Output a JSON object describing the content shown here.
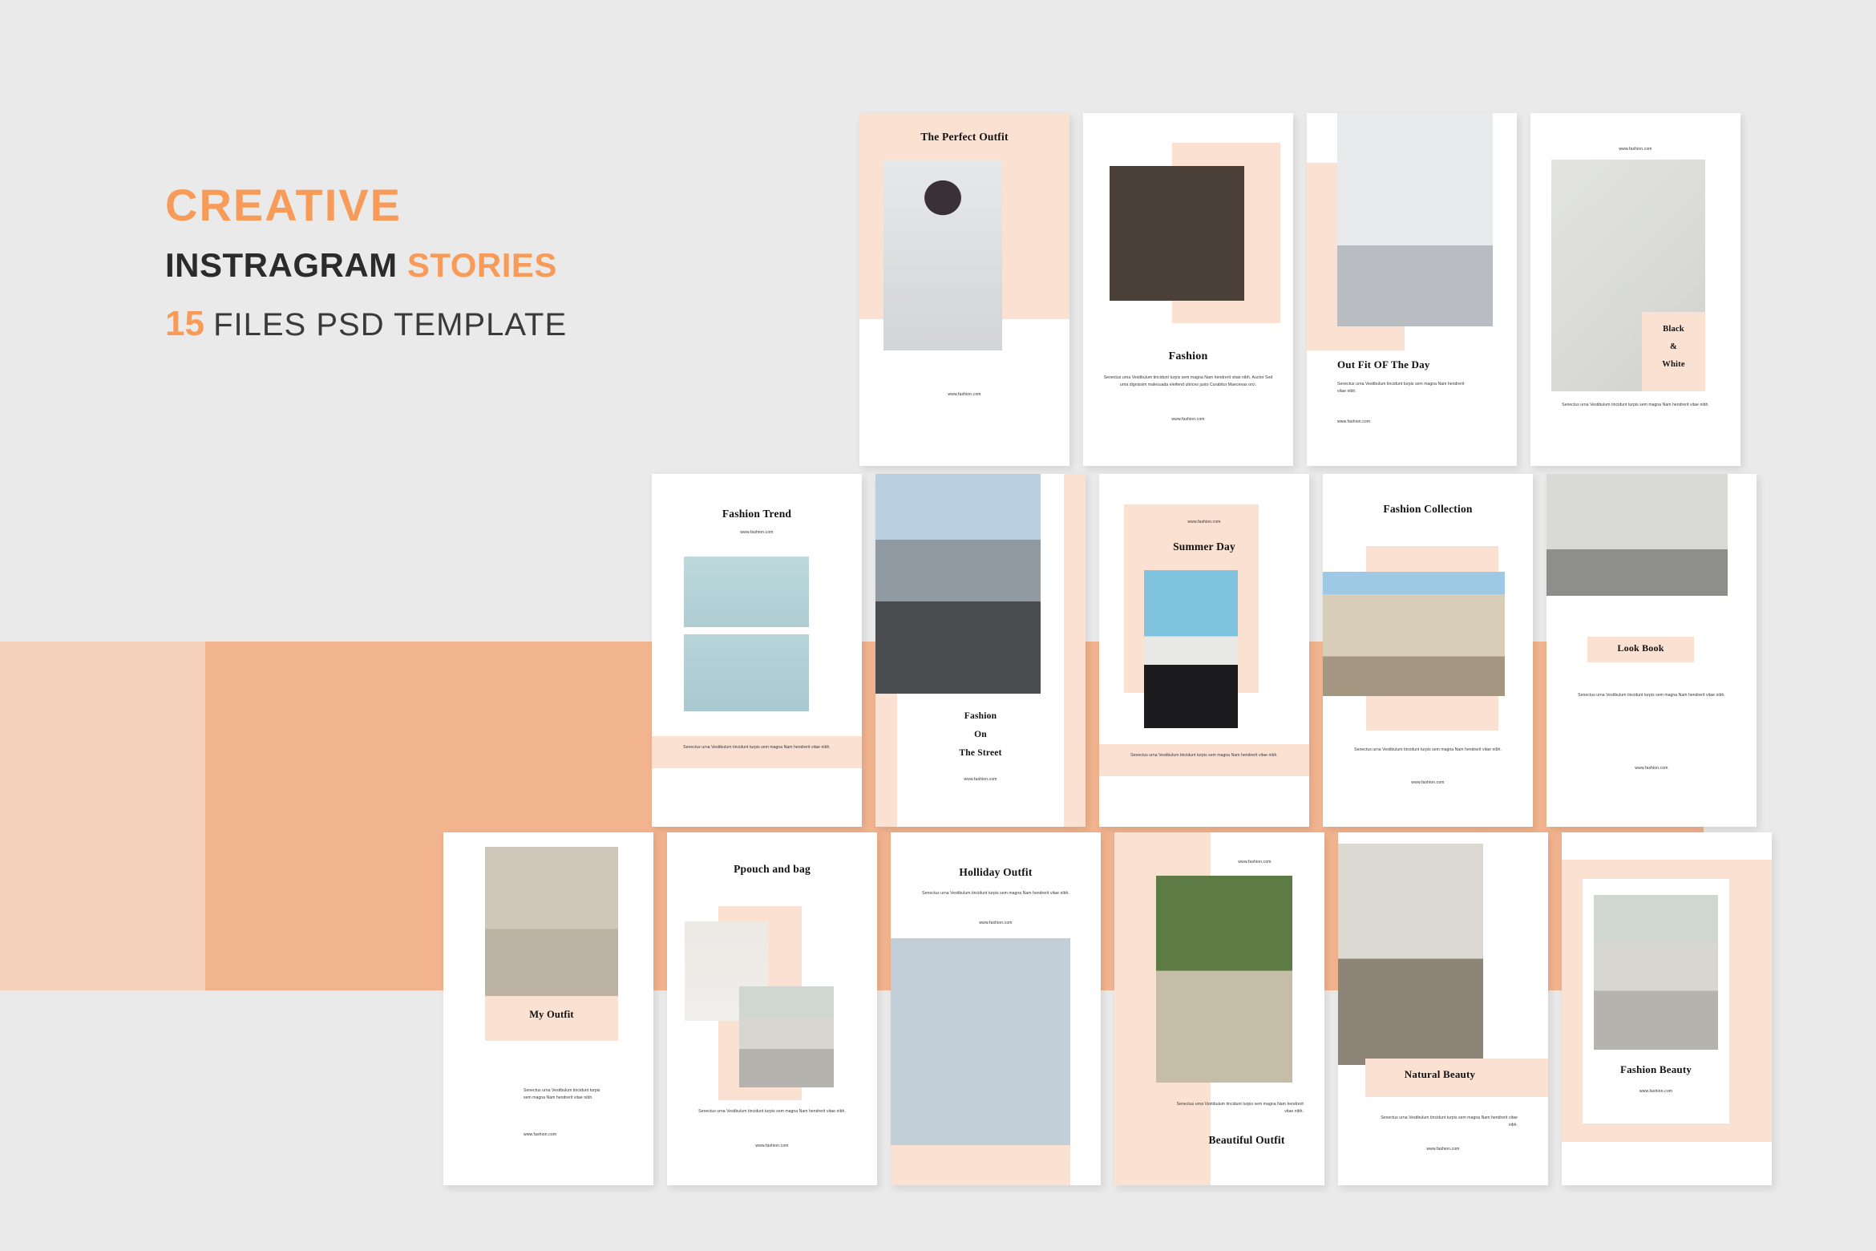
{
  "colors": {
    "page_bg": "#eaeaea",
    "band_light": "#f7d2ba",
    "band_dark": "#f2b48e",
    "accent_orange": "#f89b58",
    "card_peach": "#fbe1d2",
    "heading_dark": "#2b2b2b"
  },
  "headline": {
    "line1": "CREATIVE",
    "line2_dark": "INSTRAGRAM",
    "line2_accent": "STORIES",
    "line3_number": "15",
    "line3_rest": "FILES PSD TEMPLATE"
  },
  "common": {
    "url": "www.fashion.com",
    "body_short": "Senectus urna Vestibulum tincidunt turpis sem magna Nam hendrerit vitae nibh.",
    "body_long": "Senectus urna Vestibulum tincidunt turpis sem magna Nam hendrerit vitae nibh. Auctor Sed urna dignissim malesuada eleifend ultrices justo Curabitur Maecenas orci."
  },
  "cards": [
    {
      "id": "the-perfect-outfit",
      "title": "The Perfect Outfit",
      "url": "www.fashion.com"
    },
    {
      "id": "fashion",
      "title": "Fashion",
      "body": "Senectus urna Vestibulum tincidunt turpis sem magna Nam hendrerit vitae nibh. Auctor Sed urna dignissim malesuada eleifend ultrices justo Curabitur Maecenas orci.",
      "url": "www.fashion.com"
    },
    {
      "id": "out-fit-of-the-day",
      "title": "Out Fit OF The Day",
      "body": "Senectus urna Vestibulum tincidunt turpis sem magna Nam hendrerit vitae nibh.",
      "url": "www.fashion.com"
    },
    {
      "id": "black-and-white",
      "title_line1": "Black",
      "title_line2": "&",
      "title_line3": "White",
      "body": "Senectus urna Vestibulum tincidunt turpis sem magna Nam hendrerit vitae nibh.",
      "url": "www.fashion.com"
    },
    {
      "id": "fashion-trend",
      "title": "Fashion Trend",
      "body": "Senectus urna Vestibulum tincidunt turpis sem magna Nam hendrerit vitae nibh.",
      "url": "www.fashion.com"
    },
    {
      "id": "fashion-on-the-street",
      "title_line1": "Fashion",
      "title_line2": "On",
      "title_line3": "The Street",
      "url": "www.fashion.com"
    },
    {
      "id": "summer-day",
      "title": "Summer Day",
      "body": "Senectus urna Vestibulum tincidunt turpis sem magna Nam hendrerit vitae nibh.",
      "url": "www.fashion.com"
    },
    {
      "id": "fashion-collection",
      "title": "Fashion Collection",
      "body": "Senectus urna Vestibulum tincidunt turpis sem magna Nam hendrerit vitae nibh.",
      "url": "www.fashion.com"
    },
    {
      "id": "look-book",
      "title": "Look Book",
      "body": "Senectus urna Vestibulum tincidunt turpis sem magna Nam hendrerit vitae nibh.",
      "url": "www.fashion.com"
    },
    {
      "id": "my-outfit",
      "title": "My Outfit",
      "body": "Senectus urna Vestibulum tincidunt turpis sem magna Nam hendrerit vitae nibh.",
      "url": "www.fashion.com"
    },
    {
      "id": "ppouch-and-bag",
      "title": "Ppouch and bag",
      "body": "Senectus urna Vestibulum tincidunt turpis sem magna Nam hendrerit vitae nibh.",
      "url": "www.fashion.com"
    },
    {
      "id": "holliday-outfit",
      "title": "Holliday Outfit",
      "body": "Senectus urna Vestibulum tincidunt turpis sem magna Nam hendrerit vitae nibh.",
      "url": "www.fashion.com"
    },
    {
      "id": "beautiful-outfit",
      "title": "Beautiful Outfit",
      "body": "Senectus urna Vestibulum tincidunt turpis sem magna Nam hendrerit vitae nibh.",
      "url": "www.fashion.com"
    },
    {
      "id": "natural-beauty",
      "title": "Natural Beauty",
      "body": "Senectus urna Vestibulum tincidunt turpis sem magna Nam hendrerit vitae nibh.",
      "url": "www.fashion.com"
    },
    {
      "id": "fashion-beauty",
      "title": "Fashion Beauty",
      "url": "www.fashion.com"
    }
  ]
}
